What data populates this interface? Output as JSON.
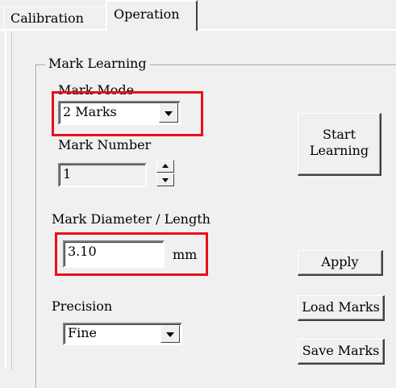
{
  "tabs": [
    {
      "label": "Calibration",
      "active": false
    },
    {
      "label": "Operation",
      "active": true
    }
  ],
  "group": {
    "title": "Mark Learning"
  },
  "mark_mode": {
    "label": "Mark Mode",
    "value": "2 Marks"
  },
  "mark_number": {
    "label": "Mark Number",
    "value": "1"
  },
  "mark_diameter": {
    "label": "Mark Diameter / Length",
    "value": "3.10",
    "unit": "mm"
  },
  "precision": {
    "label": "Precision",
    "value": "Fine"
  },
  "buttons": {
    "start_learning_line1": "Start",
    "start_learning_line2": "Learning",
    "apply": "Apply",
    "load_marks": "Load Marks",
    "save_marks": "Save Marks"
  },
  "colors": {
    "highlight": "#e8101a",
    "background": "#f0f0f0"
  }
}
